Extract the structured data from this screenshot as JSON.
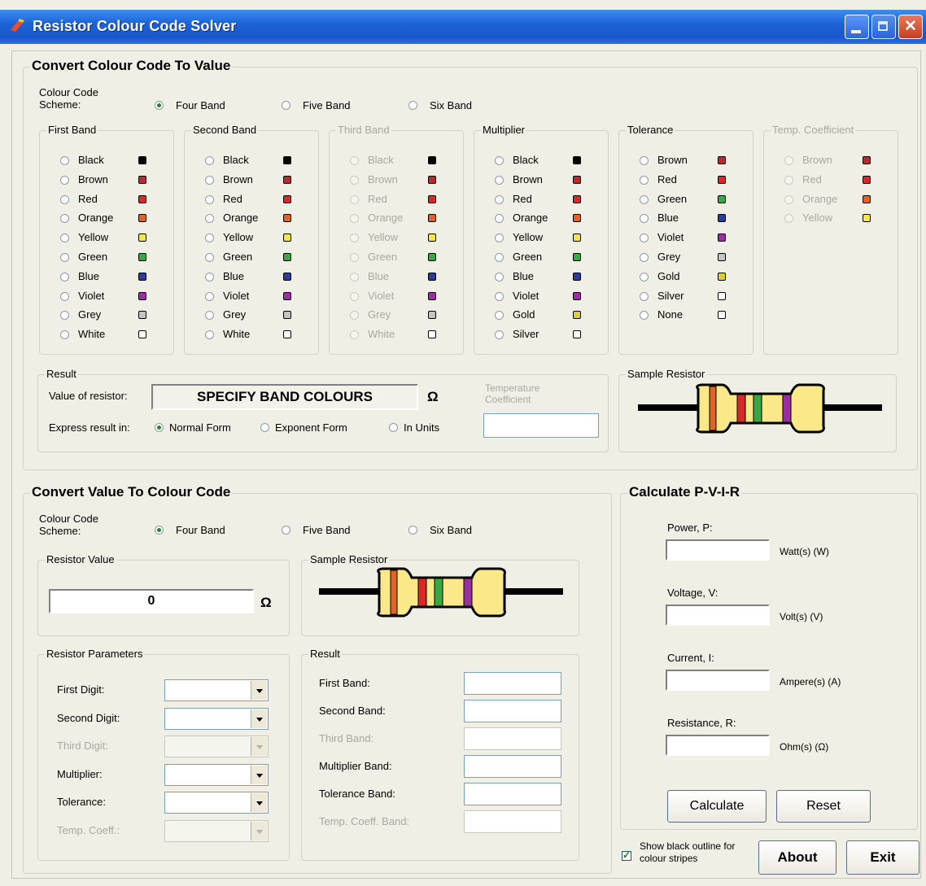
{
  "window": {
    "title": "Resistor Colour Code Solver"
  },
  "top": {
    "title": "Convert Colour Code To Value",
    "scheme_label": "Colour Code Scheme:",
    "schemes": [
      "Four Band",
      "Five Band",
      "Six Band"
    ],
    "selected_scheme": "Four Band",
    "bands": [
      {
        "label": "First Band",
        "enabled": true,
        "options": [
          "Black",
          "Brown",
          "Red",
          "Orange",
          "Yellow",
          "Green",
          "Blue",
          "Violet",
          "Grey",
          "White"
        ]
      },
      {
        "label": "Second Band",
        "enabled": true,
        "options": [
          "Black",
          "Brown",
          "Red",
          "Orange",
          "Yellow",
          "Green",
          "Blue",
          "Violet",
          "Grey",
          "White"
        ]
      },
      {
        "label": "Third Band",
        "enabled": false,
        "options": [
          "Black",
          "Brown",
          "Red",
          "Orange",
          "Yellow",
          "Green",
          "Blue",
          "Violet",
          "Grey",
          "White"
        ]
      },
      {
        "label": "Multiplier",
        "enabled": true,
        "options": [
          "Black",
          "Brown",
          "Red",
          "Orange",
          "Yellow",
          "Green",
          "Blue",
          "Violet",
          "Gold",
          "Silver"
        ]
      },
      {
        "label": "Tolerance",
        "enabled": true,
        "options": [
          "Brown",
          "Red",
          "Green",
          "Blue",
          "Violet",
          "Grey",
          "Gold",
          "Silver",
          "None"
        ]
      },
      {
        "label": "Temp. Coefficient",
        "enabled": false,
        "options": [
          "Brown",
          "Red",
          "Orange",
          "Yellow"
        ]
      }
    ],
    "result": {
      "label": "Result",
      "value_label": "Value of resistor:",
      "value": "SPECIFY BAND COLOURS",
      "unit": "Ω",
      "temp_label": "Temperature Coefficient",
      "express_label": "Express result in:",
      "express_options": [
        "Normal Form",
        "Exponent Form",
        "In Units"
      ],
      "selected_express": "Normal Form"
    },
    "sample_label": "Sample Resistor"
  },
  "bottom": {
    "title": "Convert Value To Colour Code",
    "scheme_label": "Colour Code Scheme:",
    "schemes": [
      "Four Band",
      "Five Band",
      "Six Band"
    ],
    "selected_scheme": "Four Band",
    "resistor_value_label": "Resistor Value",
    "resistor_value": "0",
    "unit": "Ω",
    "sample_label": "Sample Resistor",
    "params_label": "Resistor Parameters",
    "params": [
      {
        "label": "First Digit:",
        "enabled": true
      },
      {
        "label": "Second Digit:",
        "enabled": true
      },
      {
        "label": "Third Digit:",
        "enabled": false
      },
      {
        "label": "Multiplier:",
        "enabled": true
      },
      {
        "label": "Tolerance:",
        "enabled": true
      },
      {
        "label": "Temp. Coeff.:",
        "enabled": false
      }
    ],
    "result_label": "Result",
    "results": [
      {
        "label": "First Band:",
        "enabled": true
      },
      {
        "label": "Second Band:",
        "enabled": true
      },
      {
        "label": "Third Band:",
        "enabled": false
      },
      {
        "label": "Multiplier Band:",
        "enabled": true
      },
      {
        "label": "Tolerance Band:",
        "enabled": true
      },
      {
        "label": "Temp. Coeff. Band:",
        "enabled": false
      }
    ]
  },
  "pvir": {
    "title": "Calculate P-V-I-R",
    "rows": [
      {
        "label": "Power, P:",
        "unit": "Watt(s) (W)"
      },
      {
        "label": "Voltage, V:",
        "unit": "Volt(s) (V)"
      },
      {
        "label": "Current, I:",
        "unit": "Ampere(s) (A)"
      },
      {
        "label": "Resistance, R:",
        "unit": "Ohm(s) (Ω)"
      }
    ],
    "calculate": "Calculate",
    "reset": "Reset"
  },
  "footer": {
    "outline_label": "Show black outline for colour stripes",
    "outline_checked": true,
    "about": "About",
    "exit": "Exit"
  },
  "colors": {
    "Black": "#000000",
    "Brown": "#b32d2d",
    "Red": "#d42a2a",
    "Orange": "#e0632a",
    "Yellow": "#f3e64a",
    "Green": "#3aa845",
    "Blue": "#2b3d9a",
    "Violet": "#9a2fa2",
    "Grey": "#c4c4c4",
    "White": "#ffffff",
    "Gold": "#d9cf3a",
    "Silver": "#ffffff",
    "None": "#ffffff",
    "resistor_body": "#fae889"
  },
  "sample_stripes": [
    "Orange",
    "Red",
    "Green",
    "Violet"
  ]
}
